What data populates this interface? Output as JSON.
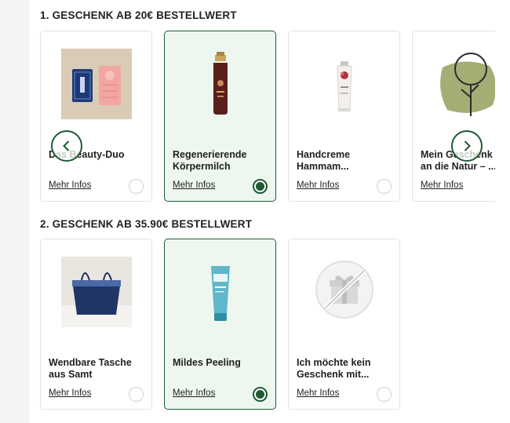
{
  "sections": [
    {
      "title": "1. GESCHENK AB 20€ BESTELLWERT",
      "items": [
        {
          "name": "Das Beauty-Duo",
          "more": "Mehr Infos",
          "selected": false,
          "icon": "beauty-duo-image"
        },
        {
          "name": "Regenerierende\nKörpermilch",
          "more": "Mehr Infos",
          "selected": true,
          "icon": "body-milk-bottle-image"
        },
        {
          "name": "Handcreme\nHammam...",
          "more": "Mehr Infos",
          "selected": false,
          "icon": "hand-cream-tube-image"
        },
        {
          "name": "Mein Geschenk\nan die Natur – ...",
          "more": "Mehr Infos",
          "selected": false,
          "icon": "tree-image"
        }
      ]
    },
    {
      "title": "2. GESCHENK AB 35.90€ BESTELLWERT",
      "items": [
        {
          "name": "Wendbare Tasche\naus Samt",
          "more": "Mehr Infos",
          "selected": false,
          "icon": "velvet-bag-image"
        },
        {
          "name": "Mildes Peeling",
          "more": "Mehr Infos",
          "selected": true,
          "icon": "peeling-tube-image"
        },
        {
          "name": "Ich möchte kein\nGeschenk mit...",
          "more": "Mehr Infos",
          "selected": false,
          "icon": "no-gift-icon"
        }
      ]
    }
  ],
  "colors": {
    "accent": "#1e5a32",
    "selected_bg": "#eef7ef",
    "border": "#e2e2e2"
  },
  "carousel": {
    "prev_icon": "chevron-left-icon",
    "next_icon": "chevron-right-icon"
  }
}
